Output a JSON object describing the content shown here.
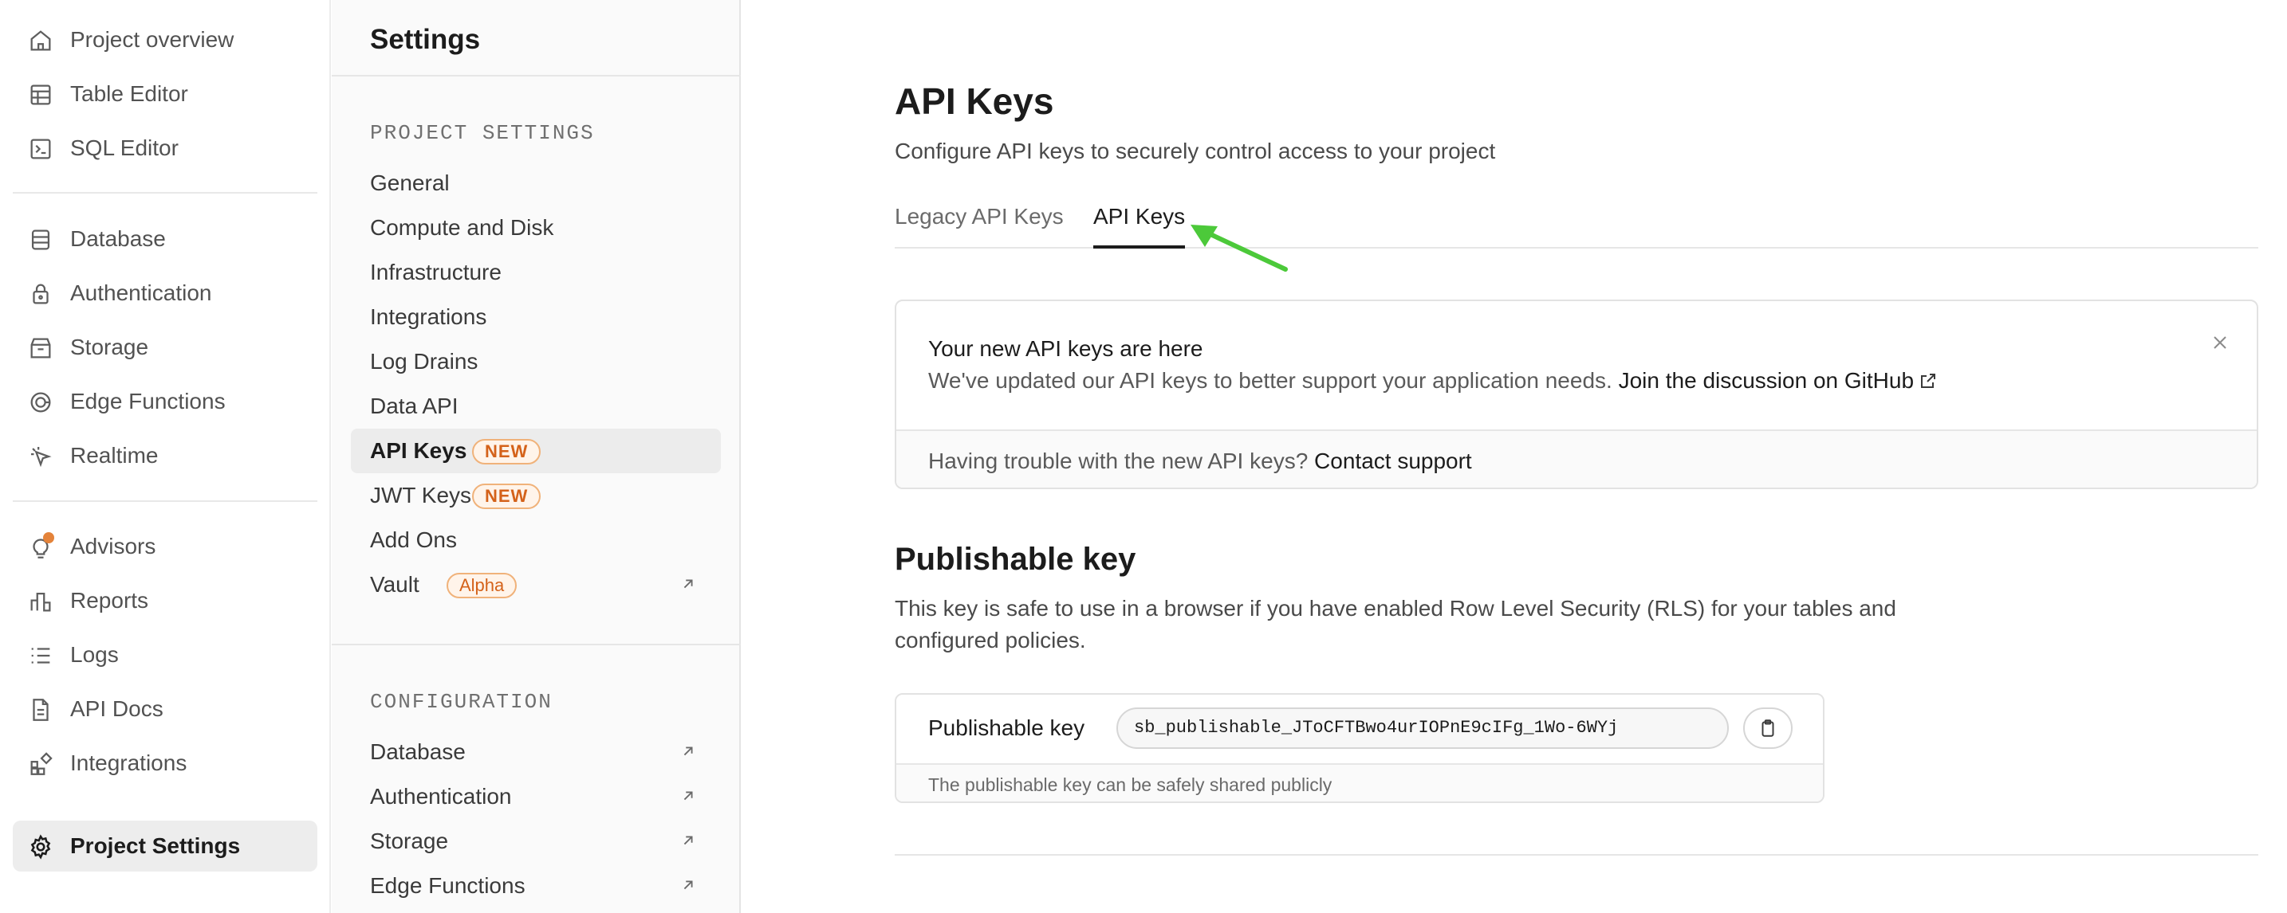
{
  "nav": {
    "items": [
      {
        "label": "Project overview",
        "icon": "home-icon"
      },
      {
        "label": "Table Editor",
        "icon": "table-icon"
      },
      {
        "label": "SQL Editor",
        "icon": "terminal-icon"
      },
      {
        "label": "Database",
        "icon": "database-icon"
      },
      {
        "label": "Authentication",
        "icon": "lock-icon"
      },
      {
        "label": "Storage",
        "icon": "archive-icon"
      },
      {
        "label": "Edge Functions",
        "icon": "edge-functions-icon"
      },
      {
        "label": "Realtime",
        "icon": "cursor-icon"
      },
      {
        "label": "Advisors",
        "icon": "lightbulb-icon"
      },
      {
        "label": "Reports",
        "icon": "chart-icon"
      },
      {
        "label": "Logs",
        "icon": "list-icon"
      },
      {
        "label": "API Docs",
        "icon": "document-icon"
      },
      {
        "label": "Integrations",
        "icon": "grid-plus-icon"
      },
      {
        "label": "Project Settings",
        "icon": "gear-icon"
      }
    ],
    "active": "Project Settings"
  },
  "settings": {
    "title": "Settings",
    "project_section": "PROJECT SETTINGS",
    "project_items": [
      {
        "label": "General"
      },
      {
        "label": "Compute and Disk"
      },
      {
        "label": "Infrastructure"
      },
      {
        "label": "Integrations"
      },
      {
        "label": "Log Drains"
      },
      {
        "label": "Data API"
      },
      {
        "label": "API Keys",
        "badge": "NEW"
      },
      {
        "label": "JWT Keys",
        "badge": "NEW"
      },
      {
        "label": "Add Ons"
      },
      {
        "label": "Vault",
        "badge": "Alpha"
      }
    ],
    "config_section": "CONFIGURATION",
    "config_items": [
      {
        "label": "Database"
      },
      {
        "label": "Authentication"
      },
      {
        "label": "Storage"
      },
      {
        "label": "Edge Functions"
      }
    ]
  },
  "main": {
    "title": "API Keys",
    "subtitle": "Configure API keys to securely control access to your project",
    "tabs": [
      {
        "label": "Legacy API Keys"
      },
      {
        "label": "API Keys"
      }
    ],
    "active_tab": "API Keys",
    "notice": {
      "title": "Your new API keys are here",
      "body": "We've updated our API keys to better support your application needs.",
      "link": "Join the discussion on GitHub",
      "footer_text": "Having trouble with the new API keys?",
      "footer_link": "Contact support"
    },
    "publishable": {
      "title": "Publishable key",
      "description": "This key is safe to use in a browser if you have enabled Row Level Security (RLS) for your tables and configured policies.",
      "field_label": "Publishable key",
      "value": "sb_publishable_JToCFTBwo4urIOPnE9cIFg_1Wo-6WYj",
      "hint": "The publishable key can be safely shared publicly"
    }
  },
  "colors": {
    "accent_badge": "#d4621a",
    "annotation_arrow": "#4cc93a"
  }
}
